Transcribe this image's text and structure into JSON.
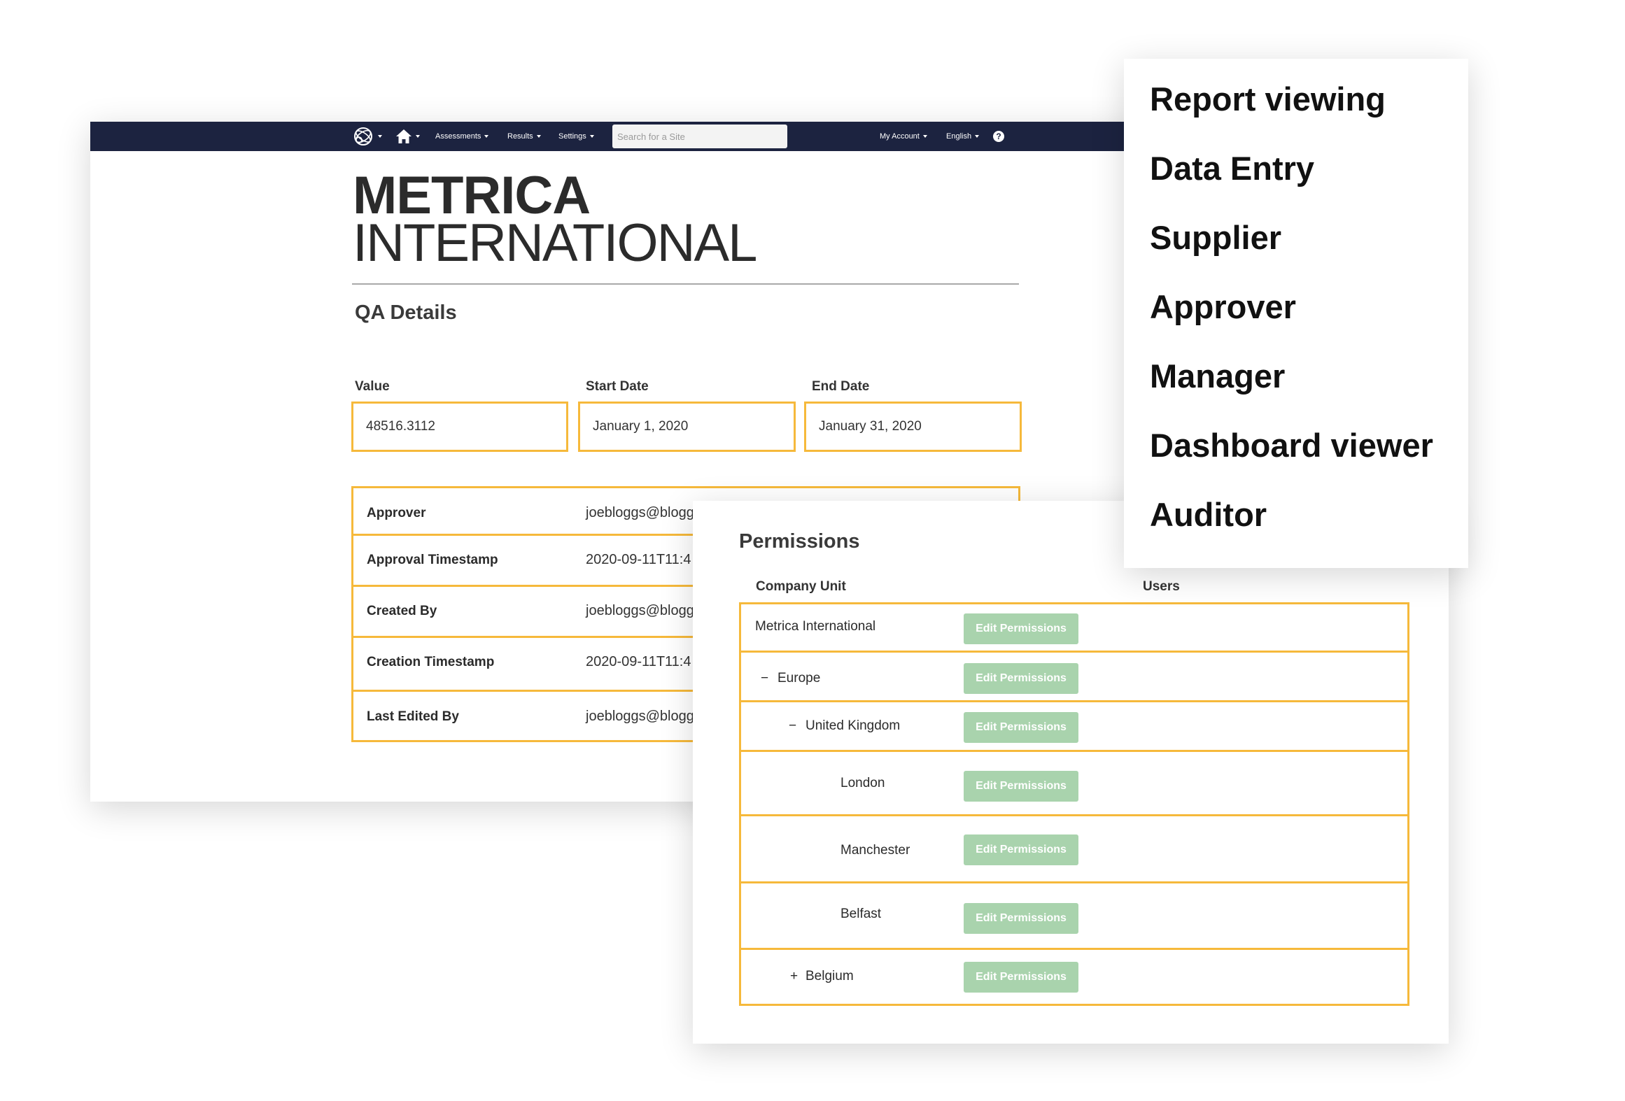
{
  "nav": {
    "assessments": "Assessments",
    "results": "Results",
    "settings": "Settings",
    "search_placeholder": "Search for a Site",
    "my_account": "My Account",
    "language": "English",
    "help": "?"
  },
  "brand": {
    "line1": "METRICA",
    "line2": "INTERNATIONAL"
  },
  "qa": {
    "title": "QA Details",
    "fields": [
      {
        "label": "Value",
        "value": "48516.3112"
      },
      {
        "label": "Start Date",
        "value": "January 1, 2020"
      },
      {
        "label": "End Date",
        "value": "January 31, 2020"
      }
    ],
    "meta": [
      {
        "key": "Approver",
        "value": "joebloggs@bloggs"
      },
      {
        "key": "Approval Timestamp",
        "value": "2020-09-11T11:4"
      },
      {
        "key": "Created By",
        "value": "joebloggs@bloggs"
      },
      {
        "key": "Creation Timestamp",
        "value": "2020-09-11T11:4"
      },
      {
        "key": "Last Edited By",
        "value": "joebloggs@bloggs"
      }
    ]
  },
  "permissions": {
    "title": "Permissions",
    "col_unit": "Company Unit",
    "col_users": "Users",
    "edit_label": "Edit Permissions",
    "rows": [
      {
        "unit": "Metrica International",
        "toggle": ""
      },
      {
        "unit": "Europe",
        "toggle": "−"
      },
      {
        "unit": "United Kingdom",
        "toggle": "−"
      },
      {
        "unit": "London",
        "toggle": ""
      },
      {
        "unit": "Manchester",
        "toggle": ""
      },
      {
        "unit": "Belfast",
        "toggle": ""
      },
      {
        "unit": "Belgium",
        "toggle": "+"
      }
    ]
  },
  "roles": [
    "Report viewing",
    "Data Entry",
    "Supplier",
    "Approver",
    "Manager",
    "Dashboard viewer",
    "Auditor"
  ],
  "colors": {
    "navbar": "#1c2340",
    "accent_border": "#f6b93b",
    "button_green": "#a9d3ad"
  },
  "icons": {
    "logo": "globe-logo-icon",
    "home": "home-icon",
    "dropdown": "caret-down-icon",
    "help": "help-icon"
  }
}
